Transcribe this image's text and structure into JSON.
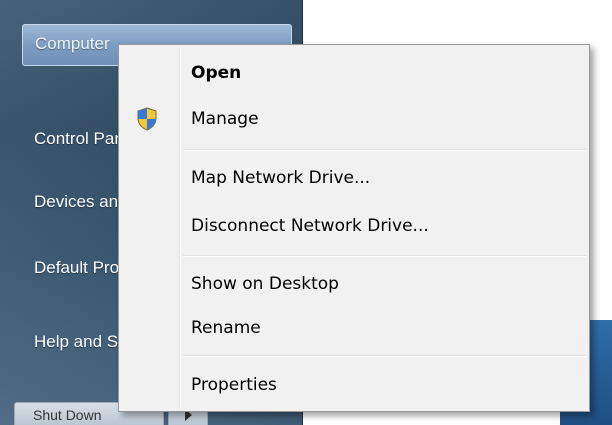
{
  "start_menu": {
    "items": [
      {
        "label": "Computer"
      },
      {
        "label": "Control Panel"
      },
      {
        "label": "Devices and Printers"
      },
      {
        "label": "Default Programs"
      },
      {
        "label": "Help and Support"
      }
    ],
    "shutdown_label": "Shut Down"
  },
  "context_menu": {
    "items": [
      {
        "label": "Open",
        "bold": true,
        "icon": ""
      },
      {
        "label": "Manage",
        "icon": "uac-shield-icon"
      },
      {
        "label": "Map Network Drive..."
      },
      {
        "label": "Disconnect Network Drive..."
      },
      {
        "label": "Show on Desktop"
      },
      {
        "label": "Rename"
      },
      {
        "label": "Properties"
      }
    ]
  },
  "colors": {
    "menu_bg": "#f1f1f1",
    "pane_bg": "#34536f",
    "hover_bg": "#7d9cc2"
  }
}
